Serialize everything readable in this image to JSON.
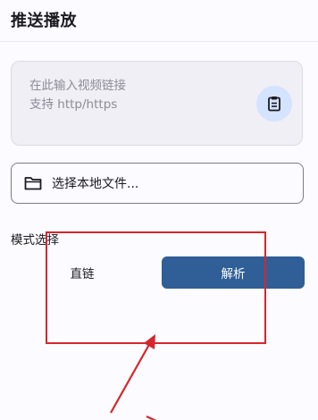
{
  "header": {
    "title": "推送播放"
  },
  "url_input": {
    "placeholder": "在此输入视频链接\n支持 http/https"
  },
  "paste_button": {
    "icon": "clipboard-icon"
  },
  "file_picker": {
    "icon": "folder-icon",
    "label": "选择本地文件..."
  },
  "mode": {
    "label": "模式选择",
    "options": [
      "直链",
      "解析"
    ],
    "selected": "解析"
  },
  "annotation": {
    "color": "#d6262c"
  },
  "colors": {
    "accent": "#2f5f96",
    "paste_button_bg": "#d4e3ff"
  }
}
